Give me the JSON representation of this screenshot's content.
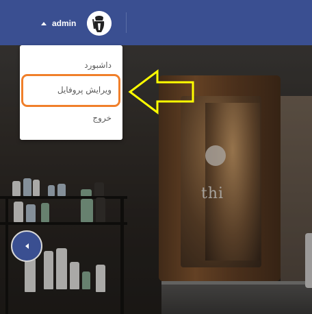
{
  "navbar": {
    "username": "admin",
    "background_color": "#3a4f91",
    "avatar_icon": "chef-avatar-icon",
    "caret_icon": "caret-up-icon"
  },
  "dropdown": {
    "items": [
      {
        "label": "داشبورد"
      },
      {
        "label": "ویرایش پروفایل",
        "highlighted": true
      },
      {
        "label": "خروج"
      }
    ],
    "highlight_color": "#f07f2a"
  },
  "annotation": {
    "arrow_icon": "left-arrow-icon",
    "arrow_color": "#ffff00"
  },
  "side_button": {
    "icon": "chevron-left-icon"
  },
  "background": {
    "brand_text": "thi"
  }
}
